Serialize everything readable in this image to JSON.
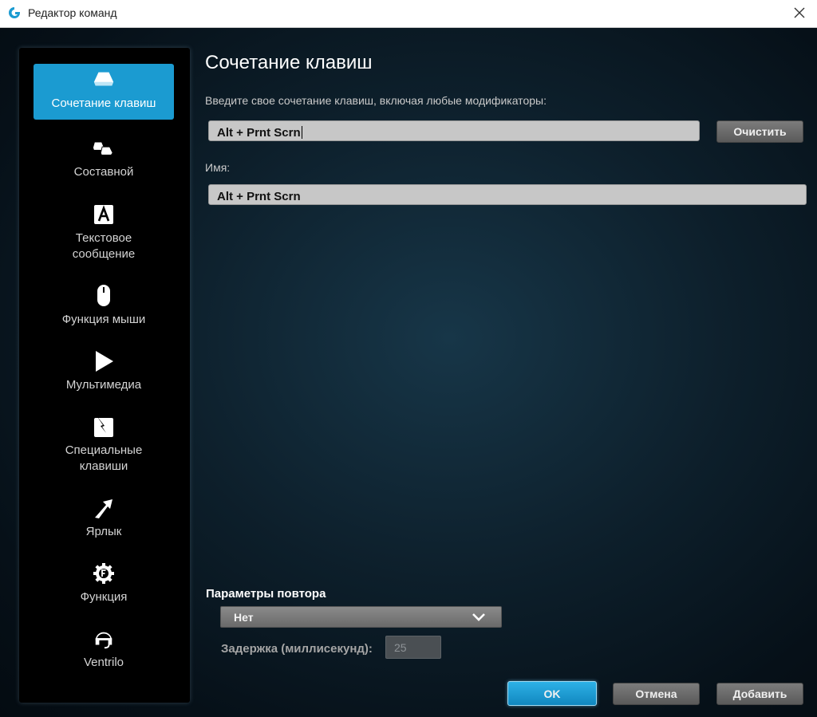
{
  "window": {
    "title": "Редактор команд",
    "logo_icon": "logitech-g-icon",
    "close_icon": "close-icon"
  },
  "sidebar": {
    "items": [
      {
        "label": "Сочетание клавиш",
        "icon": "keyboard-key-icon",
        "active": true
      },
      {
        "label": "Составной",
        "icon": "multi-key-icon",
        "active": false
      },
      {
        "label": "Текстовое\nсообщение",
        "icon": "text-a-icon",
        "active": false
      },
      {
        "label": "Функция мыши",
        "icon": "mouse-icon",
        "active": false
      },
      {
        "label": "Мультимедиа",
        "icon": "play-icon",
        "active": false
      },
      {
        "label": "Специальные\nклавиши",
        "icon": "special-key-icon",
        "active": false
      },
      {
        "label": "Ярлык",
        "icon": "shortcut-arrow-icon",
        "active": false
      },
      {
        "label": "Функция",
        "icon": "function-gear-icon",
        "active": false
      },
      {
        "label": "Ventrilo",
        "icon": "headset-icon",
        "active": false
      }
    ]
  },
  "main": {
    "title": "Сочетание клавиш",
    "shortcut_prompt": "Введите свое сочетание клавиш, включая любые модификаторы:",
    "shortcut_value": "Alt + Prnt Scrn",
    "clear_label": "Очистить",
    "name_label": "Имя:",
    "name_value": "Alt + Prnt Scrn",
    "repeat": {
      "label": "Параметры повтора",
      "selected": "Нет",
      "delay_label": "Задержка (миллисекунд):",
      "delay_value": "25"
    }
  },
  "footer": {
    "ok_label": "OK",
    "cancel_label": "Отмена",
    "add_label": "Добавить"
  },
  "colors": {
    "accent": "#1b9bd1",
    "background": "#0d1f2b"
  }
}
